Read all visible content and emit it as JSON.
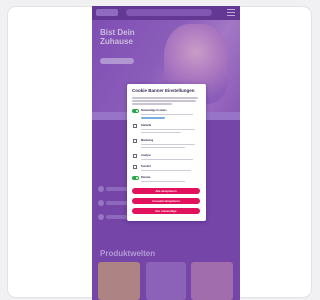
{
  "site": {
    "hero_title": "Bist Dein Zuhause"
  },
  "cookie_dialog": {
    "title": "Cookie Banner Einstellungen",
    "options": [
      {
        "label": "Notwendige Cookies",
        "type": "toggle",
        "enabled": true
      },
      {
        "label": "Statistik",
        "type": "checkbox",
        "enabled": false
      },
      {
        "label": "Marketing",
        "type": "checkbox",
        "enabled": false
      },
      {
        "label": "Analyse",
        "type": "checkbox",
        "enabled": false
      },
      {
        "label": "Komfort",
        "type": "checkbox",
        "enabled": false
      },
      {
        "label": "Dienste",
        "type": "toggle",
        "enabled": true
      }
    ],
    "buttons": {
      "accept_all": "Alle akzeptieren",
      "accept_selected": "Auswahl akzeptieren",
      "reject": "Nur notwendige"
    }
  },
  "section": {
    "title": "Produktwelten"
  },
  "colors": {
    "page_overlay": "#7f4fb3",
    "accept_button": "#e2115c",
    "toggle_on": "#27a84a"
  }
}
